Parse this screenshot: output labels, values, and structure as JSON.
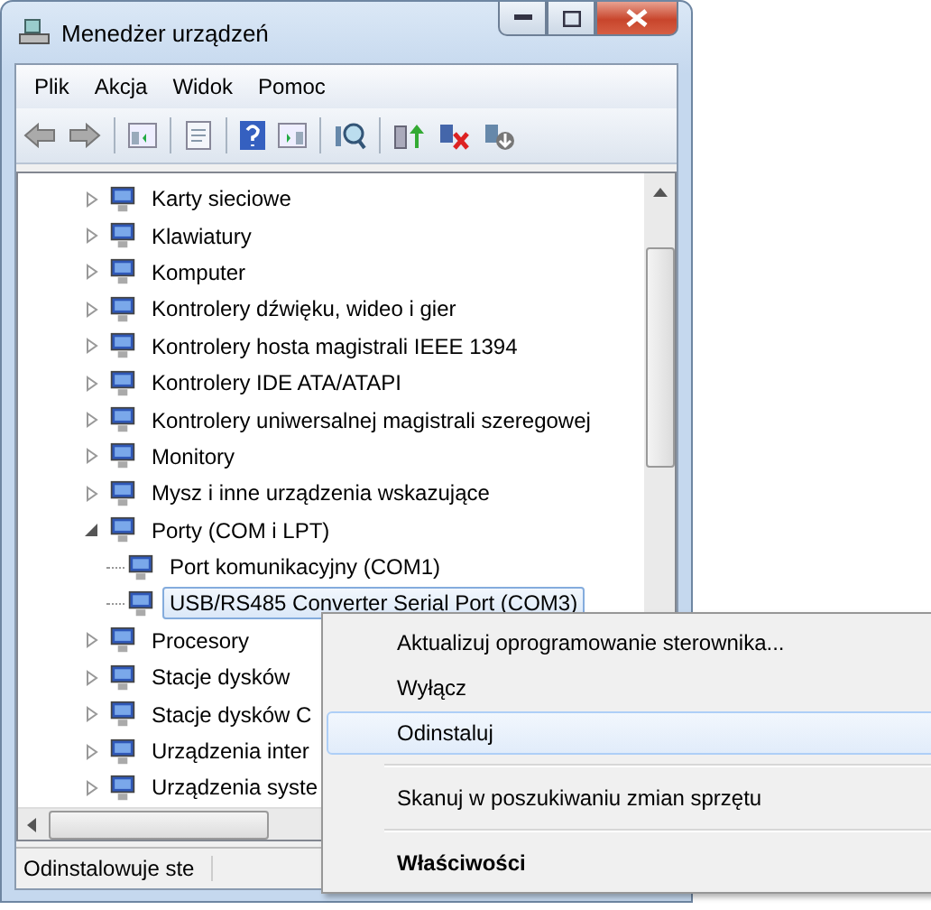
{
  "window": {
    "title": "Menedżer urządzeń"
  },
  "menu": [
    "Plik",
    "Akcja",
    "Widok",
    "Pomoc"
  ],
  "tree": [
    {
      "label": "Karty sieciowe",
      "expanded": false,
      "selected": false
    },
    {
      "label": "Klawiatury",
      "expanded": false,
      "selected": false
    },
    {
      "label": "Komputer",
      "expanded": false,
      "selected": false
    },
    {
      "label": "Kontrolery dźwięku, wideo i gier",
      "expanded": false,
      "selected": false
    },
    {
      "label": "Kontrolery hosta magistrali IEEE 1394",
      "expanded": false,
      "selected": false
    },
    {
      "label": "Kontrolery IDE ATA/ATAPI",
      "expanded": false,
      "selected": false
    },
    {
      "label": "Kontrolery uniwersalnej magistrali szeregowej",
      "expanded": false,
      "selected": false
    },
    {
      "label": "Monitory",
      "expanded": false,
      "selected": false
    },
    {
      "label": "Mysz i inne urządzenia wskazujące",
      "expanded": false,
      "selected": false
    },
    {
      "label": "Porty (COM i LPT)",
      "expanded": true,
      "selected": false,
      "children": [
        {
          "label": "Port komunikacyjny (COM1)",
          "selected": false
        },
        {
          "label": "USB/RS485 Converter Serial Port (COM3)",
          "selected": true
        }
      ]
    },
    {
      "label": "Procesory",
      "expanded": false,
      "selected": false
    },
    {
      "label": "Stacje dysków",
      "expanded": false,
      "selected": false
    },
    {
      "label": "Stacje dysków C",
      "expanded": false,
      "selected": false
    },
    {
      "label": "Urządzenia inter",
      "expanded": false,
      "selected": false
    },
    {
      "label": "Urządzenia syste",
      "expanded": false,
      "selected": false
    }
  ],
  "context_menu": [
    {
      "kind": "item",
      "label": "Aktualizuj oprogramowanie sterownika...",
      "selected": false,
      "bold": false
    },
    {
      "kind": "item",
      "label": "Wyłącz",
      "selected": false,
      "bold": false
    },
    {
      "kind": "item",
      "label": "Odinstaluj",
      "selected": true,
      "bold": false
    },
    {
      "kind": "separator"
    },
    {
      "kind": "item",
      "label": "Skanuj w poszukiwaniu zmian sprzętu",
      "selected": false,
      "bold": false
    },
    {
      "kind": "separator"
    },
    {
      "kind": "item",
      "label": "Właściwości",
      "selected": false,
      "bold": true
    }
  ],
  "status_bar": "Odinstalowuje ste"
}
